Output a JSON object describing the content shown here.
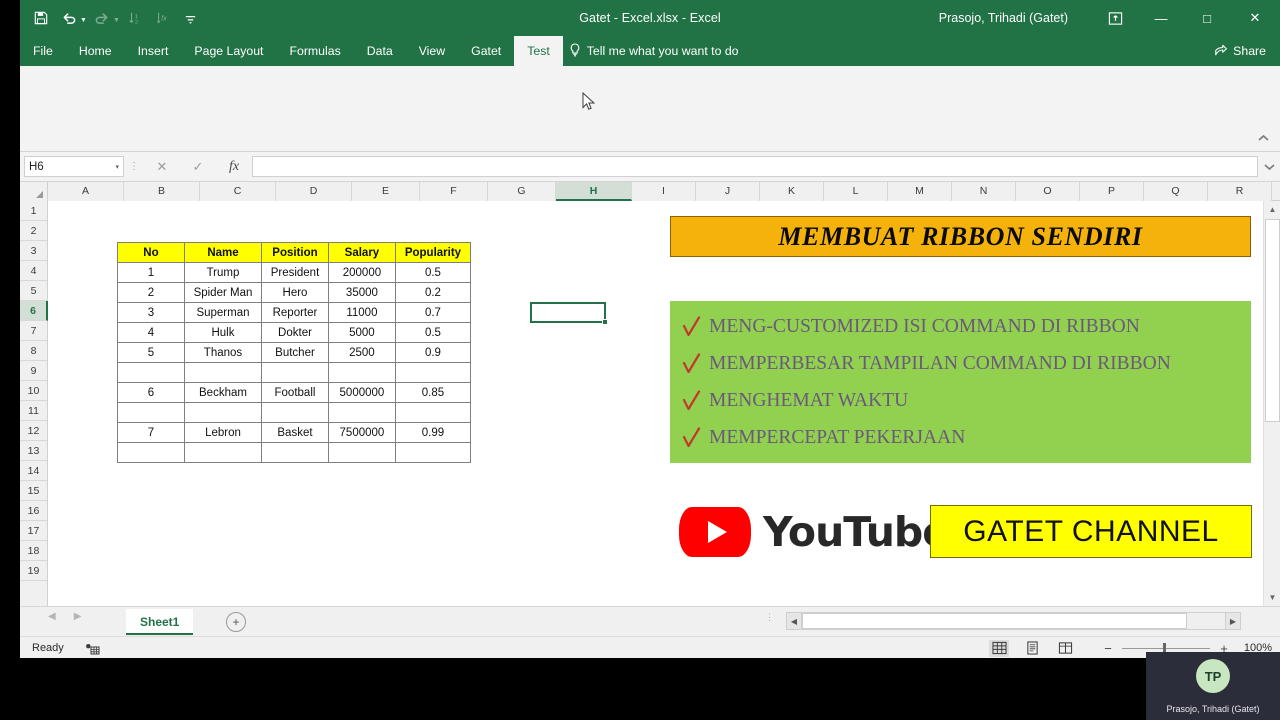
{
  "window": {
    "title": "Gatet - Excel.xlsx  -  Excel",
    "user": "Prasojo, Trihadi (Gatet)",
    "ribbon_display_icon": "ribbon-display-options-icon",
    "minimize": "—",
    "maximize": "□",
    "close": "✕"
  },
  "quick_access": [
    {
      "name": "save-icon",
      "label": "Save",
      "dim": false
    },
    {
      "name": "undo-icon",
      "label": "Undo",
      "dim": false
    },
    {
      "name": "redo-icon",
      "label": "Redo",
      "dim": true
    },
    {
      "name": "sort-icon",
      "label": "Sort",
      "dim": true
    },
    {
      "name": "insert-function-icon",
      "label": "Insert Function",
      "dim": true
    },
    {
      "name": "customize-quick-access-toolbar-icon",
      "label": "Customize",
      "dim": false
    }
  ],
  "tabs": [
    {
      "label": "File",
      "active": false
    },
    {
      "label": "Home",
      "active": false
    },
    {
      "label": "Insert",
      "active": false
    },
    {
      "label": "Page Layout",
      "active": false
    },
    {
      "label": "Formulas",
      "active": false
    },
    {
      "label": "Data",
      "active": false
    },
    {
      "label": "View",
      "active": false
    },
    {
      "label": "Gatet",
      "active": false
    },
    {
      "label": "Test",
      "active": true
    }
  ],
  "tellme": {
    "label": "Tell me what you want to do",
    "icon": "lightbulb-icon"
  },
  "share": {
    "label": "Share",
    "icon": "share-icon"
  },
  "ribbon": {
    "collapse_icon": "chevron-up-icon",
    "content": ""
  },
  "formula_bar": {
    "name_box": "H6",
    "name_box_caret": "▾",
    "cancel_icon": "✕",
    "enter_icon": "✓",
    "function_icon": "fx",
    "value": "",
    "expand_icon": "chevron-down-icon"
  },
  "grid": {
    "columns": [
      "A",
      "B",
      "C",
      "D",
      "E",
      "F",
      "G",
      "H",
      "I",
      "J",
      "K",
      "L",
      "M",
      "N",
      "O",
      "P",
      "Q",
      "R"
    ],
    "selected_column": "H",
    "rows": [
      "1",
      "2",
      "3",
      "4",
      "5",
      "6",
      "7",
      "8",
      "9",
      "10",
      "11",
      "12",
      "13",
      "14",
      "15",
      "16",
      "17",
      "18",
      "19"
    ],
    "selected_row": "6",
    "active_cell": "H6"
  },
  "data_table": {
    "headers": [
      "No",
      "Name",
      "Position",
      "Salary",
      "Popularity"
    ],
    "rows": [
      [
        "1",
        "Trump",
        "President",
        "200000",
        "0.5"
      ],
      [
        "2",
        "Spider Man",
        "Hero",
        "35000",
        "0.2"
      ],
      [
        "3",
        "Superman",
        "Reporter",
        "11000",
        "0.7"
      ],
      [
        "4",
        "Hulk",
        "Dokter",
        "5000",
        "0.5"
      ],
      [
        "5",
        "Thanos",
        "Butcher",
        "2500",
        "0.9"
      ],
      [
        "",
        "",
        "",
        "",
        ""
      ],
      [
        "6",
        "Beckham",
        "Football",
        "5000000",
        "0.85"
      ],
      [
        "",
        "",
        "",
        "",
        ""
      ],
      [
        "7",
        "Lebron",
        "Basket",
        "7500000",
        "0.99"
      ],
      [
        "",
        "",
        "",
        "",
        ""
      ]
    ],
    "header_bg": "#ffff00"
  },
  "banner": {
    "text": "MEMBUAT RIBBON SENDIRI",
    "bg": "#f5b20a"
  },
  "benefits": {
    "bg": "#92d050",
    "check_color": "#c0392b",
    "items": [
      "MENG-CUSTOMIZED ISI COMMAND DI RIBBON",
      "MEMPERBESAR TAMPILAN COMMAND DI RIBBON",
      "MENGHEMAT WAKTU",
      "MEMPERCEPAT PEKERJAAN"
    ]
  },
  "youtube": {
    "wordmark": "YouTube",
    "icon": "youtube-play-icon",
    "brand_color": "#ff0000"
  },
  "channel_badge": {
    "text": "GATET CHANNEL",
    "bg": "#ffff00"
  },
  "sheet_bar": {
    "prev_icon": "◀",
    "next_icon": "▶",
    "sheets": [
      "Sheet1"
    ],
    "active_sheet": "Sheet1",
    "add_sheet_icon": "+"
  },
  "status_bar": {
    "status": "Ready",
    "macro_icon": "record-macro-icon",
    "views": [
      {
        "name": "normal-view-button",
        "icon": "grid-icon",
        "active": true
      },
      {
        "name": "page-layout-view-button",
        "icon": "page-icon",
        "active": false
      },
      {
        "name": "page-break-preview-button",
        "icon": "pagebreak-icon",
        "active": false
      }
    ],
    "zoom_out": "−",
    "zoom_in": "+",
    "zoom_level": "100%"
  },
  "webcam": {
    "initials": "TP",
    "name": "Prasojo, Trihadi (Gatet)"
  }
}
